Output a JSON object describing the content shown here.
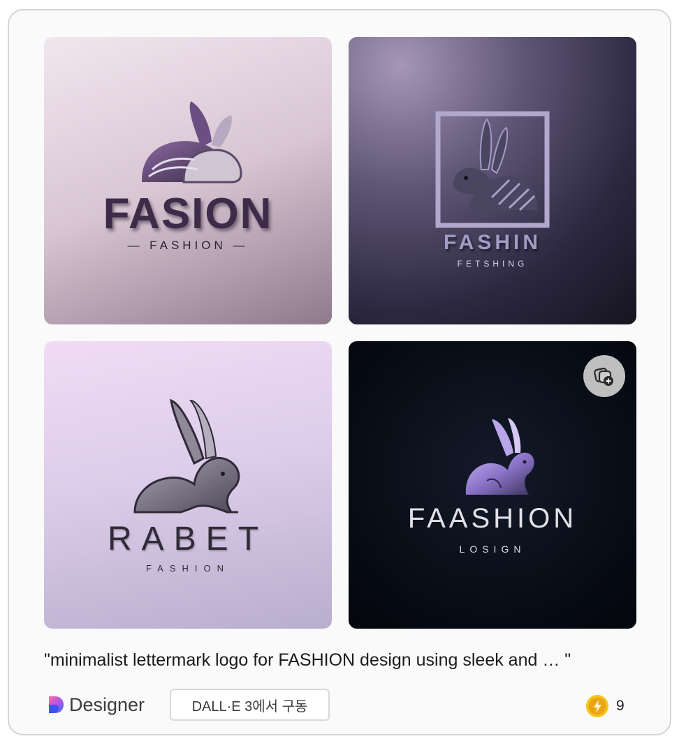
{
  "images": [
    {
      "title": "FASION",
      "subtitle": "— FASHION —"
    },
    {
      "title": "FASHIN",
      "subtitle": "FETSHING"
    },
    {
      "title": "RABET",
      "subtitle": "FASHION"
    },
    {
      "title": "FAASHION",
      "subtitle": "LOSIGN"
    }
  ],
  "prompt_caption": "\"minimalist lettermark logo for FASHION design using sleek and … \"",
  "footer": {
    "brand_label": "Designer",
    "engine_badge": "DALL·E 3에서 구동",
    "boost_count": "9"
  },
  "icons": {
    "add_to_collection": "add-to-collection-icon",
    "brand": "designer-logo-icon",
    "boost": "boost-coin-icon"
  },
  "colors": {
    "card_border": "#d4d4d4",
    "boost_coin": "#f5c518"
  }
}
